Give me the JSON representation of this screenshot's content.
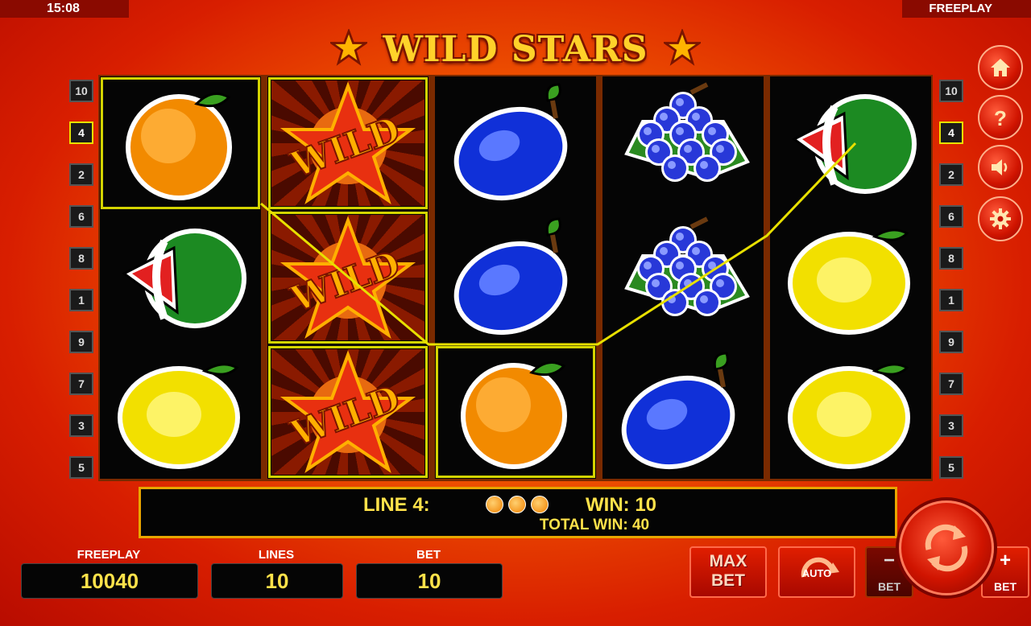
{
  "status_bar": {
    "time": "15:08",
    "mode": "FREEPLAY"
  },
  "game": {
    "title": "WILD STARS"
  },
  "paylines": {
    "left": [
      "10",
      "4",
      "2",
      "6",
      "8",
      "1",
      "9",
      "7",
      "3",
      "5"
    ],
    "right": [
      "10",
      "4",
      "2",
      "6",
      "8",
      "1",
      "9",
      "7",
      "3",
      "5"
    ],
    "active": "4"
  },
  "reels": [
    [
      "orange",
      "watermelon",
      "lemon"
    ],
    [
      "wild",
      "wild",
      "wild"
    ],
    [
      "plum",
      "plum",
      "orange"
    ],
    [
      "grapes",
      "grapes",
      "plum"
    ],
    [
      "watermelon",
      "lemon",
      "lemon"
    ]
  ],
  "win_info": {
    "line_label": "LINE 4:",
    "win_label": "WIN: 10",
    "total_win_label": "TOTAL WIN: 40"
  },
  "side_menu": {
    "home_icon": "home-icon",
    "help_icon": "help-icon",
    "sound_icon": "speaker-icon",
    "settings_icon": "gear-icon"
  },
  "bottom": {
    "credits_label": "FREEPLAY",
    "credits_value": "10040",
    "lines_label": "LINES",
    "lines_value": "10",
    "bet_label": "BET",
    "bet_value": "10",
    "max_bet_line1": "MAX",
    "max_bet_line2": "BET",
    "auto_label": "AUTO",
    "bet_minus_sign": "−",
    "bet_minus_label": "BET",
    "bet_plus_sign": "+",
    "bet_plus_label": "BET"
  },
  "colors": {
    "accent_yellow": "#ffe24a",
    "win_outline": "#d4d400",
    "button_red": "#d01400"
  }
}
